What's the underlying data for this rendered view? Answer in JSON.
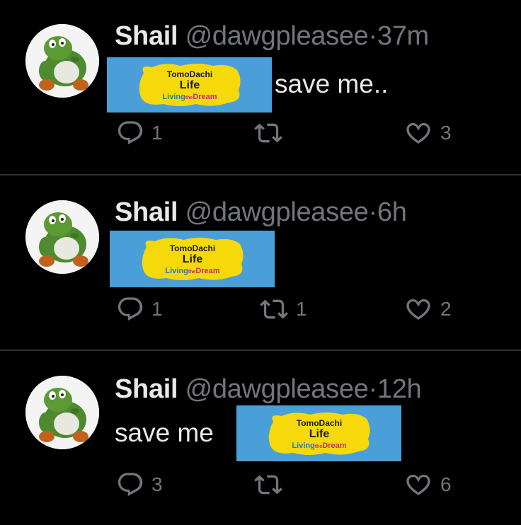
{
  "tweets": [
    {
      "name": "Shail",
      "handle": "@dawgpleasee",
      "separator": "·",
      "time": "37m",
      "text": "save me..",
      "replies": "1",
      "retweets": "",
      "likes": "3"
    },
    {
      "name": "Shail",
      "handle": "@dawgpleasee",
      "separator": "·",
      "time": "6h",
      "text": "",
      "replies": "1",
      "retweets": "1",
      "likes": "2"
    },
    {
      "name": "Shail",
      "handle": "@dawgpleasee",
      "separator": "·",
      "time": "12h",
      "text": "save me",
      "replies": "3",
      "retweets": "",
      "likes": "6"
    }
  ],
  "logo": {
    "line1": "TomoDachi",
    "line2": "Life",
    "line3a": "Living",
    "line3b": "the",
    "line3c": "Dream"
  },
  "colors": {
    "background": "#000000",
    "primary_text": "#e7e9ea",
    "secondary_text": "#71767b",
    "logo_box": "#4a9fd8",
    "logo_blob": "#f5d90a",
    "divider": "#2f3336"
  },
  "icons": [
    "reply-icon",
    "retweet-icon",
    "like-icon"
  ]
}
